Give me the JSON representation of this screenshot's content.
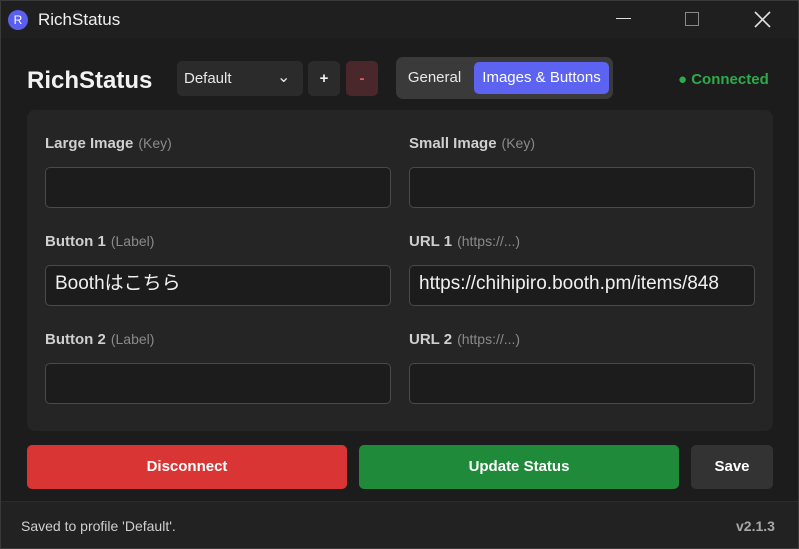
{
  "window": {
    "title": "RichStatus",
    "icon_letter": "R",
    "controls": {
      "minimize": "minimize",
      "maximize": "maximize",
      "close": "close"
    }
  },
  "header": {
    "brand": "RichStatus",
    "profile_select": {
      "value": "Default",
      "options": [
        "Default"
      ]
    },
    "add_label": "+",
    "remove_label": "-",
    "tabs": [
      {
        "label": "General",
        "active": false
      },
      {
        "label": "Images & Buttons",
        "active": true
      }
    ],
    "status": "● Connected"
  },
  "form": {
    "large_image": {
      "label": "Large Image",
      "hint": "(Key)",
      "value": ""
    },
    "small_image": {
      "label": "Small Image",
      "hint": "(Key)",
      "value": ""
    },
    "button1": {
      "label": "Button 1",
      "hint": "(Label)",
      "value": "Boothはこちら"
    },
    "url1": {
      "label": "URL 1",
      "hint": "(https://...)",
      "value": "https://chihipiro.booth.pm/items/848"
    },
    "button2": {
      "label": "Button 2",
      "hint": "(Label)",
      "value": ""
    },
    "url2": {
      "label": "URL 2",
      "hint": "(https://...)",
      "value": ""
    }
  },
  "actions": {
    "disconnect": "Disconnect",
    "update": "Update Status",
    "save": "Save"
  },
  "footer": {
    "message": "Saved to profile 'Default'.",
    "version": "v2.1.3"
  },
  "colors": {
    "accent": "#5c63f0",
    "connected": "#2eaa4a",
    "danger": "#d93535",
    "success": "#1f8a3a"
  }
}
